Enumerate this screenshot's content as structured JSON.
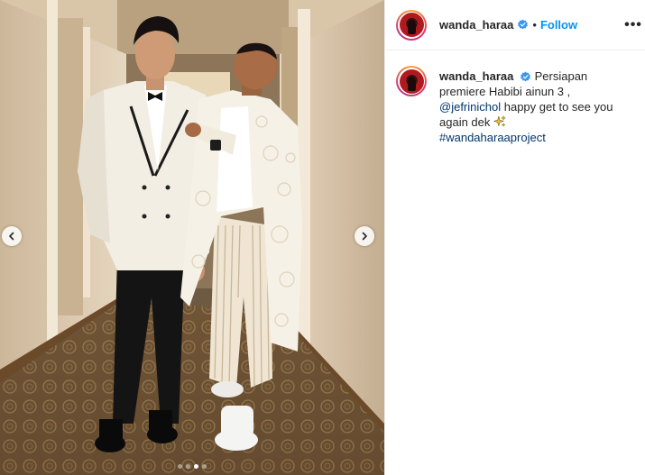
{
  "post": {
    "username": "wanda_haraa",
    "separator": "•",
    "follow_label": "Follow",
    "more_label": "•••",
    "caption": {
      "username": "wanda_haraa",
      "text_part1": " Persiapan premiere Habibi ainun 3 , ",
      "mention": "@jefrinichol",
      "text_part2": " happy get to see you again dek ",
      "hashtag": "#wandaharaaproject"
    }
  },
  "carousel": {
    "total_slides": 4,
    "active_index": 2
  },
  "colors": {
    "follow": "#0095f6",
    "link": "#00376b",
    "verified": "#3897f0"
  },
  "icons": {
    "prev": "chevron-left-icon",
    "next": "chevron-right-icon",
    "verified": "verified-badge-icon",
    "sparkle": "sparkles-icon"
  }
}
